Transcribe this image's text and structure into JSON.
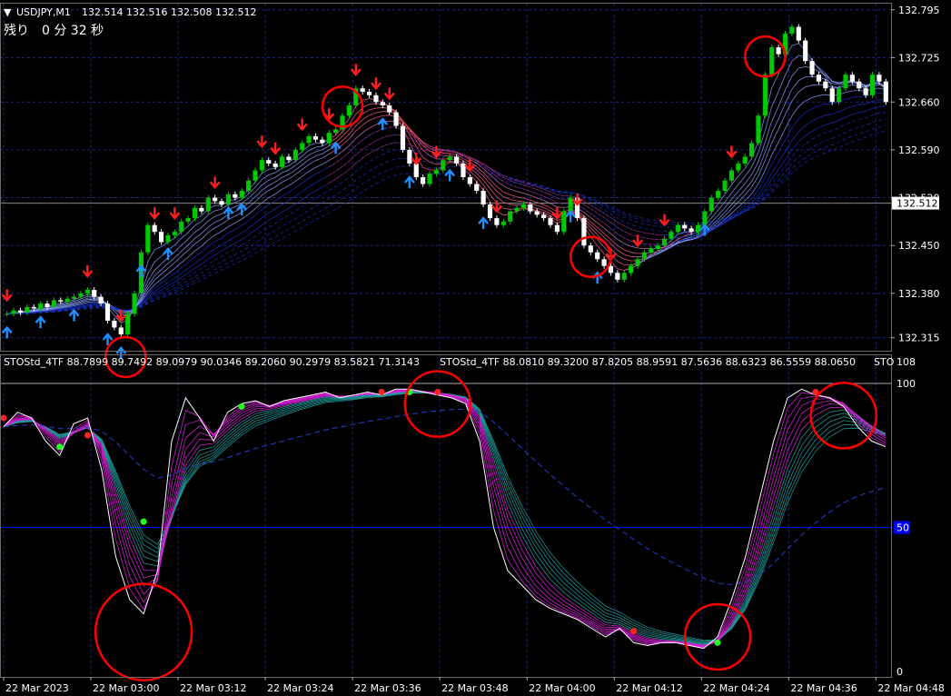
{
  "header": {
    "symbol": "USDJPY,M1",
    "ohlc": "132.514 132.516 132.508 132.512",
    "countdown": "残り　0 分 32 秒"
  },
  "indicator_header": {
    "text1": "STOStd_4TF 88.7899 89.7492 89.0979 90.0346 89.2060 90.2979 83.5821 71.3143",
    "text2": "STOStd_4TF 88.0810 89.3200 87.8205 88.9591 87.5636 88.6323 86.5559 88.0650",
    "text3": "STO"
  },
  "colors": {
    "background": "#000000",
    "grid": "#1e2a6e",
    "bull_candle": "#00c800",
    "bear_candle": "#ffffff",
    "up_arrow": "#1e90ff",
    "down_arrow": "#ff1e1e",
    "ribbon_fast": "#8aa0ff",
    "ribbon_slow": "#1830c8",
    "ribbon_red": "#ff2020",
    "osc_white": "#ffffff",
    "osc_magenta": "#e020e0",
    "osc_teal": "#20a0a0",
    "osc_dash": "#2040d0",
    "level_line": "#0000ff",
    "highlight_circle": "#ff0000",
    "dot_red": "#ff2020",
    "dot_green": "#20ff20"
  },
  "chart_data": [
    {
      "type": "candlestick",
      "symbol": "USDJPY",
      "timeframe": "M1",
      "price_axis": [
        "132.795",
        "132.725",
        "132.660",
        "132.590",
        "132.520",
        "132.450",
        "132.380",
        "132.315"
      ],
      "current_price_label": "132.512",
      "ylim": [
        132.3,
        132.8
      ],
      "x_ticks": [
        "22 Mar 2023",
        "22 Mar 03:00",
        "22 Mar 03:12",
        "22 Mar 03:24",
        "22 Mar 03:36",
        "22 Mar 03:48",
        "22 Mar 04:00",
        "22 Mar 04:12",
        "22 Mar 04:24",
        "22 Mar 04:36",
        "22 Mar 04:48"
      ],
      "close": [
        132.35,
        132.355,
        132.352,
        132.36,
        132.358,
        132.365,
        132.36,
        132.37,
        132.368,
        132.372,
        132.375,
        132.38,
        132.385,
        132.375,
        132.365,
        132.34,
        132.33,
        132.32,
        132.35,
        132.38,
        132.44,
        132.48,
        132.47,
        132.455,
        132.465,
        132.47,
        132.485,
        132.49,
        132.505,
        132.5,
        132.52,
        132.515,
        132.51,
        132.525,
        132.52,
        132.53,
        132.545,
        132.56,
        132.575,
        132.57,
        132.565,
        132.58,
        132.575,
        132.59,
        132.6,
        132.61,
        132.605,
        132.6,
        132.615,
        132.62,
        132.64,
        132.655,
        132.68,
        132.675,
        132.67,
        132.66,
        132.655,
        132.645,
        132.625,
        132.59,
        132.57,
        132.55,
        132.54,
        132.555,
        132.56,
        132.575,
        132.58,
        132.57,
        132.55,
        132.54,
        132.53,
        132.51,
        132.49,
        132.48,
        132.485,
        132.5,
        132.505,
        132.51,
        132.5,
        132.495,
        132.49,
        132.48,
        132.47,
        132.5,
        132.52,
        132.49,
        132.45,
        132.44,
        132.43,
        132.42,
        132.41,
        132.4,
        132.41,
        132.42,
        132.43,
        132.44,
        132.445,
        132.45,
        132.46,
        132.47,
        132.48,
        132.475,
        132.47,
        132.48,
        132.5,
        132.52,
        132.53,
        132.545,
        132.56,
        132.57,
        132.58,
        132.6,
        132.64,
        132.7,
        132.74,
        132.73,
        132.76,
        132.77,
        132.75,
        132.72,
        132.7,
        132.69,
        132.68,
        132.66,
        132.68,
        132.7,
        132.69,
        132.68,
        132.67,
        132.7,
        132.69,
        132.66
      ],
      "annotations": {
        "highlight_circles_at_bar": [
          17,
          50,
          87,
          113
        ],
        "down_arrows_at_bar": [
          0,
          12,
          17,
          22,
          25,
          31,
          38,
          40,
          44,
          48,
          52,
          55,
          57,
          61,
          64,
          69,
          73,
          82,
          85,
          90,
          94,
          98,
          108
        ],
        "up_arrows_at_bar": [
          0,
          5,
          10,
          15,
          17,
          20,
          24,
          33,
          35,
          49,
          56,
          60,
          66,
          71,
          84,
          88,
          104
        ]
      }
    },
    {
      "type": "line",
      "name": "STOStd_4TF",
      "ylim": [
        0,
        100
      ],
      "axis_labels": [
        "108",
        "100",
        "0"
      ],
      "level_line_label": "50",
      "main": [
        85,
        90,
        88,
        80,
        75,
        86,
        88,
        70,
        40,
        25,
        20,
        35,
        80,
        95,
        88,
        80,
        90,
        93,
        94,
        92,
        94,
        95,
        96,
        97,
        95,
        96,
        97,
        96,
        98,
        98,
        97,
        96,
        95,
        93,
        80,
        50,
        35,
        30,
        25,
        22,
        20,
        18,
        15,
        12,
        15,
        10,
        9,
        10,
        10,
        9,
        8,
        12,
        25,
        40,
        60,
        80,
        95,
        98,
        96,
        95,
        92,
        85,
        80,
        78
      ],
      "dots": [
        {
          "index": 0,
          "value": 88,
          "color": "red"
        },
        {
          "index": 4,
          "value": 78,
          "color": "green"
        },
        {
          "index": 6,
          "value": 82,
          "color": "red"
        },
        {
          "index": 10,
          "value": 52,
          "color": "green"
        },
        {
          "index": 17,
          "value": 92,
          "color": "green"
        },
        {
          "index": 27,
          "value": 97,
          "color": "red"
        },
        {
          "index": 29,
          "value": 97,
          "color": "green"
        },
        {
          "index": 31,
          "value": 97,
          "color": "red"
        },
        {
          "index": 45,
          "value": 14,
          "color": "red"
        },
        {
          "index": 51,
          "value": 10,
          "color": "green"
        },
        {
          "index": 58,
          "value": 97,
          "color": "red"
        }
      ],
      "highlight_circles_at_index": [
        10,
        31,
        51,
        60
      ]
    }
  ]
}
